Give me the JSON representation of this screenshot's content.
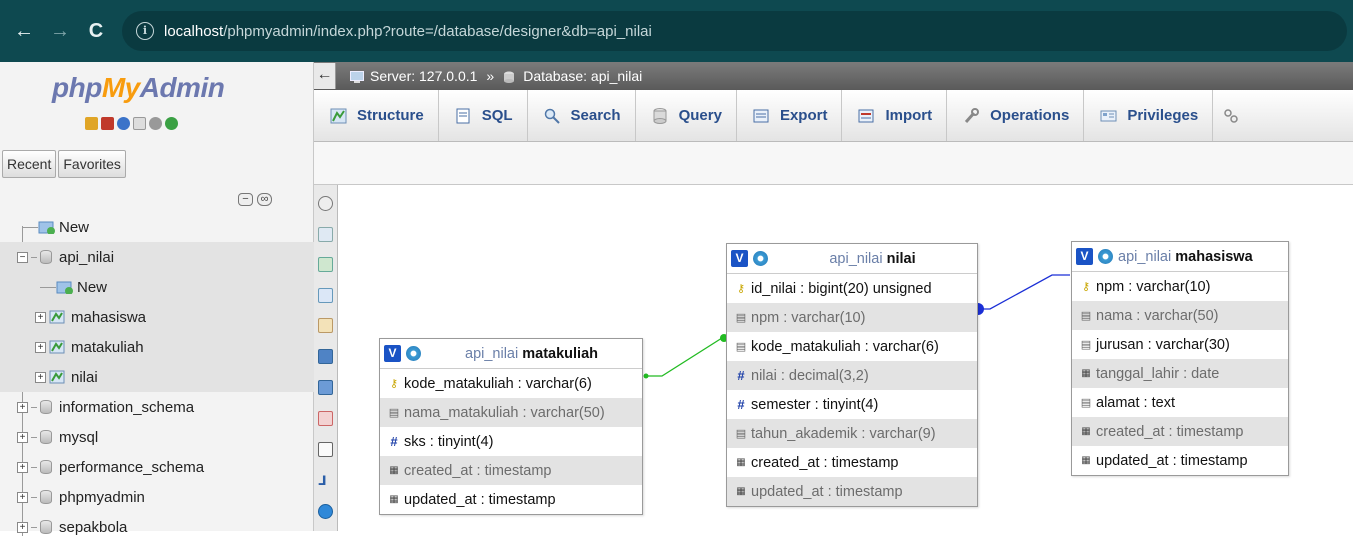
{
  "browser": {
    "url_host": "localhost",
    "url_path": "/phpmyadmin/index.php?route=/database/designer&db=api_nilai",
    "back_icon": "←",
    "forward_icon": "→",
    "reload_icon": "C",
    "info_icon": "i"
  },
  "sidebar": {
    "logo_php": "php",
    "logo_my": "My",
    "logo_admin": "Admin",
    "tabs": [
      "Recent",
      "Favorites"
    ],
    "new_label": "New",
    "databases": [
      {
        "name": "api_nilai",
        "children": [
          {
            "type": "new",
            "name": "New"
          },
          {
            "type": "table",
            "name": "mahasiswa"
          },
          {
            "type": "table",
            "name": "matakuliah"
          },
          {
            "type": "table",
            "name": "nilai"
          }
        ]
      },
      {
        "name": "information_schema"
      },
      {
        "name": "mysql"
      },
      {
        "name": "performance_schema"
      },
      {
        "name": "phpmyadmin"
      },
      {
        "name": "sepakbola"
      }
    ]
  },
  "breadcrumb": {
    "server": "Server: 127.0.0.1",
    "separator": "»",
    "database": "Database: api_nilai"
  },
  "menu": [
    {
      "label": "Structure",
      "icon": "structure-icon"
    },
    {
      "label": "SQL",
      "icon": "sql-icon"
    },
    {
      "label": "Search",
      "icon": "search-icon"
    },
    {
      "label": "Query",
      "icon": "query-icon"
    },
    {
      "label": "Export",
      "icon": "export-icon"
    },
    {
      "label": "Import",
      "icon": "import-icon"
    },
    {
      "label": "Operations",
      "icon": "wrench-icon"
    },
    {
      "label": "Privileges",
      "icon": "privileges-icon"
    }
  ],
  "designer": {
    "tables": {
      "matakuliah": {
        "db": "api_nilai",
        "name": "matakuliah",
        "columns": [
          {
            "text": "kode_matakuliah : varchar(6)",
            "icon": "key",
            "alt": false
          },
          {
            "text": "nama_matakuliah : varchar(50)",
            "icon": "field",
            "alt": true
          },
          {
            "text": "sks : tinyint(4)",
            "icon": "hash",
            "alt": false
          },
          {
            "text": "created_at : timestamp",
            "icon": "cal",
            "alt": true
          },
          {
            "text": "updated_at : timestamp",
            "icon": "cal",
            "alt": false
          }
        ]
      },
      "nilai": {
        "db": "api_nilai",
        "name": "nilai",
        "columns": [
          {
            "text": "id_nilai : bigint(20) unsigned",
            "icon": "key",
            "alt": false
          },
          {
            "text": "npm : varchar(10)",
            "icon": "field",
            "alt": true
          },
          {
            "text": "kode_matakuliah : varchar(6)",
            "icon": "field",
            "alt": false
          },
          {
            "text": "nilai : decimal(3,2)",
            "icon": "hash",
            "alt": true
          },
          {
            "text": "semester : tinyint(4)",
            "icon": "hash",
            "alt": false
          },
          {
            "text": "tahun_akademik : varchar(9)",
            "icon": "field",
            "alt": true
          },
          {
            "text": "created_at : timestamp",
            "icon": "cal",
            "alt": false
          },
          {
            "text": "updated_at : timestamp",
            "icon": "cal",
            "alt": true
          }
        ]
      },
      "mahasiswa": {
        "db": "api_nilai",
        "name": "mahasiswa",
        "columns": [
          {
            "text": "npm : varchar(10)",
            "icon": "key",
            "alt": false
          },
          {
            "text": "nama : varchar(50)",
            "icon": "field",
            "alt": true
          },
          {
            "text": "jurusan : varchar(30)",
            "icon": "field",
            "alt": false
          },
          {
            "text": "tanggal_lahir : date",
            "icon": "cal",
            "alt": true
          },
          {
            "text": "alamat : text",
            "icon": "field",
            "alt": false
          },
          {
            "text": "created_at : timestamp",
            "icon": "cal",
            "alt": true
          },
          {
            "text": "updated_at : timestamp",
            "icon": "cal",
            "alt": false
          }
        ]
      }
    },
    "v_label": "V",
    "relation_colors": {
      "matakuliah_nilai": "#22bb22",
      "nilai_mahasiswa": "#1b2fd6"
    }
  }
}
